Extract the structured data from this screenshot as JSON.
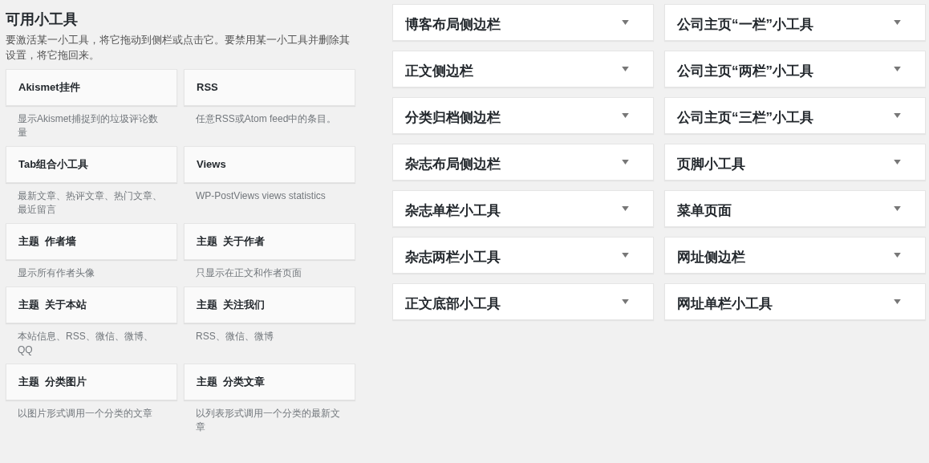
{
  "available": {
    "title": "可用小工具",
    "description": "要激活某一小工具，将它拖动到侧栏或点击它。要禁用某一小工具并删除其设置，将它拖回来。",
    "widgets": [
      {
        "title": "Akismet挂件",
        "description": "显示Akismet捕捉到的垃圾评论数量"
      },
      {
        "title": "RSS",
        "description": "任意RSS或Atom feed中的条目。"
      },
      {
        "title": "Tab组合小工具",
        "description": "最新文章、热评文章、热门文章、最近留言"
      },
      {
        "title": "Views",
        "description": "WP-PostViews views statistics"
      },
      {
        "title": "主题  作者墙",
        "description": "显示所有作者头像"
      },
      {
        "title": "主题  关于作者",
        "description": "只显示在正文和作者页面"
      },
      {
        "title": "主题  关于本站",
        "description": "本站信息、RSS、微信、微博、QQ"
      },
      {
        "title": "主题  关注我们",
        "description": "RSS、微信、微博"
      },
      {
        "title": "主题  分类图片",
        "description": "以图片形式调用一个分类的文章"
      },
      {
        "title": "主题  分类文章",
        "description": "以列表形式调用一个分类的最新文章"
      }
    ]
  },
  "sidebars": [
    {
      "title": "博客布局侧边栏"
    },
    {
      "title": "公司主页“一栏”小工具"
    },
    {
      "title": "正文侧边栏"
    },
    {
      "title": "公司主页“两栏”小工具"
    },
    {
      "title": "分类归档侧边栏"
    },
    {
      "title": "公司主页“三栏”小工具"
    },
    {
      "title": "杂志布局侧边栏"
    },
    {
      "title": "页脚小工具"
    },
    {
      "title": "杂志单栏小工具"
    },
    {
      "title": "菜单页面"
    },
    {
      "title": "杂志两栏小工具"
    },
    {
      "title": "网址侧边栏"
    },
    {
      "title": "正文底部小工具"
    },
    {
      "title": "网址单栏小工具"
    }
  ]
}
